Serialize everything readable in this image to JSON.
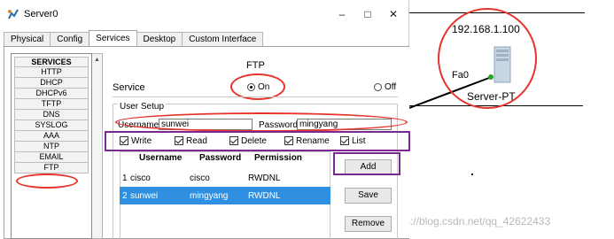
{
  "window": {
    "title": "Server0",
    "minimize": "–",
    "maximize": "□",
    "close": "✕"
  },
  "tabs": [
    {
      "label": "Physical",
      "active": false
    },
    {
      "label": "Config",
      "active": false
    },
    {
      "label": "Services",
      "active": true
    },
    {
      "label": "Desktop",
      "active": false
    },
    {
      "label": "Custom Interface",
      "active": false
    }
  ],
  "services": {
    "header": "SERVICES",
    "items": [
      "HTTP",
      "DHCP",
      "DHCPv6",
      "TFTP",
      "DNS",
      "SYSLOG",
      "AAA",
      "NTP",
      "EMAIL",
      "FTP"
    ],
    "selected": "FTP"
  },
  "ftp": {
    "title": "FTP",
    "service_label": "Service",
    "on_label": "On",
    "off_label": "Off",
    "service_state": "on",
    "user_setup_label": "User Setup",
    "username_label": "Username",
    "username_value": "sunwei",
    "password_label": "Password",
    "password_value": "mingyang",
    "permissions": [
      {
        "label": "Write",
        "checked": true
      },
      {
        "label": "Read",
        "checked": true
      },
      {
        "label": "Delete",
        "checked": true
      },
      {
        "label": "Rename",
        "checked": true
      },
      {
        "label": "List",
        "checked": true
      }
    ],
    "table": {
      "headers": [
        "Username",
        "Password",
        "Permission"
      ],
      "rows": [
        {
          "index": "1",
          "username": "cisco",
          "password": "cisco",
          "permission": "RWDNL",
          "selected": false
        },
        {
          "index": "2",
          "username": "sunwei",
          "password": "mingyang",
          "permission": "RWDNL",
          "selected": true
        }
      ]
    },
    "buttons": {
      "add": "Add",
      "save": "Save",
      "remove": "Remove"
    }
  },
  "topology": {
    "server_ip": "192.168.1.100",
    "port_label": "Fa0",
    "server_name": "Server-PT"
  },
  "watermark": "https://blog.csdn.net/qq_42622433",
  "colors": {
    "annotation_red": "#e8332d",
    "annotation_purple": "#7a2a8f",
    "selection_blue": "#2f8fe0",
    "link_green": "#1fa82b"
  }
}
